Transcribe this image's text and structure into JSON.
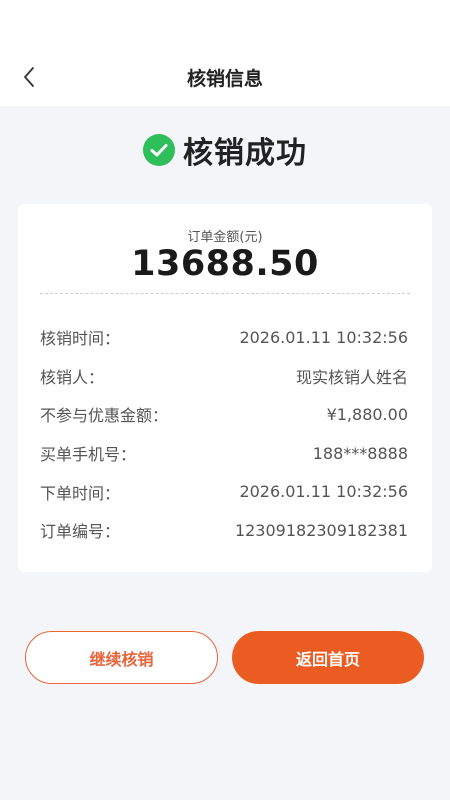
{
  "header": {
    "title": "核销信息"
  },
  "status": {
    "text": "核销成功",
    "color": "#2fbf5a"
  },
  "card": {
    "amount_label": "订单金额(元)",
    "amount_value": "13688.50",
    "rows": [
      {
        "label": "核销时间：",
        "value": "2026.01.11 10:32:56"
      },
      {
        "label": "核销人：",
        "value": "现实核销人姓名"
      },
      {
        "label": "不参与优惠金额：",
        "value": "¥1,880.00"
      },
      {
        "label": "买单手机号：",
        "value": "188***8888"
      },
      {
        "label": "下单时间：",
        "value": "2026.01.11 10:32:56"
      },
      {
        "label": "订单编号：",
        "value": "12309182309182381"
      }
    ]
  },
  "buttons": {
    "continue_label": "继续核销",
    "home_label": "返回首页"
  },
  "colors": {
    "accent": "#ea5c22",
    "success": "#2fbf5a",
    "background": "#f4f5f9"
  },
  "icons": {
    "back": "chevron-left-icon",
    "status": "check-circle-icon"
  }
}
